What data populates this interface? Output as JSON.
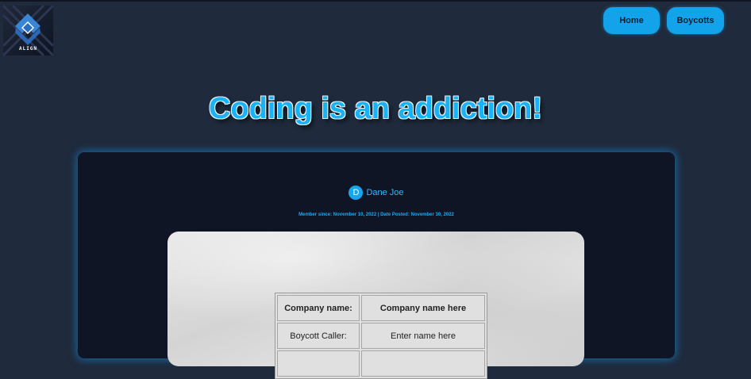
{
  "logo": {
    "text": "ALIGN"
  },
  "nav": {
    "home": "Home",
    "boycotts": "Boycotts"
  },
  "headline": "Coding is an addiction!",
  "post": {
    "avatar_initial": "D",
    "author_name": "Dane Joe",
    "meta": "Member since: November 10, 2022 | Date Posted: November 10, 2022"
  },
  "table": {
    "rows": [
      {
        "label": "Company name:",
        "value": "Company name here"
      },
      {
        "label": "Boycott Caller:",
        "value": "Enter name here"
      },
      {
        "label": "",
        "value": ""
      }
    ]
  },
  "colors": {
    "accent": "#13a3ea",
    "background": "#1f2a3c",
    "card": "#0f1525"
  }
}
